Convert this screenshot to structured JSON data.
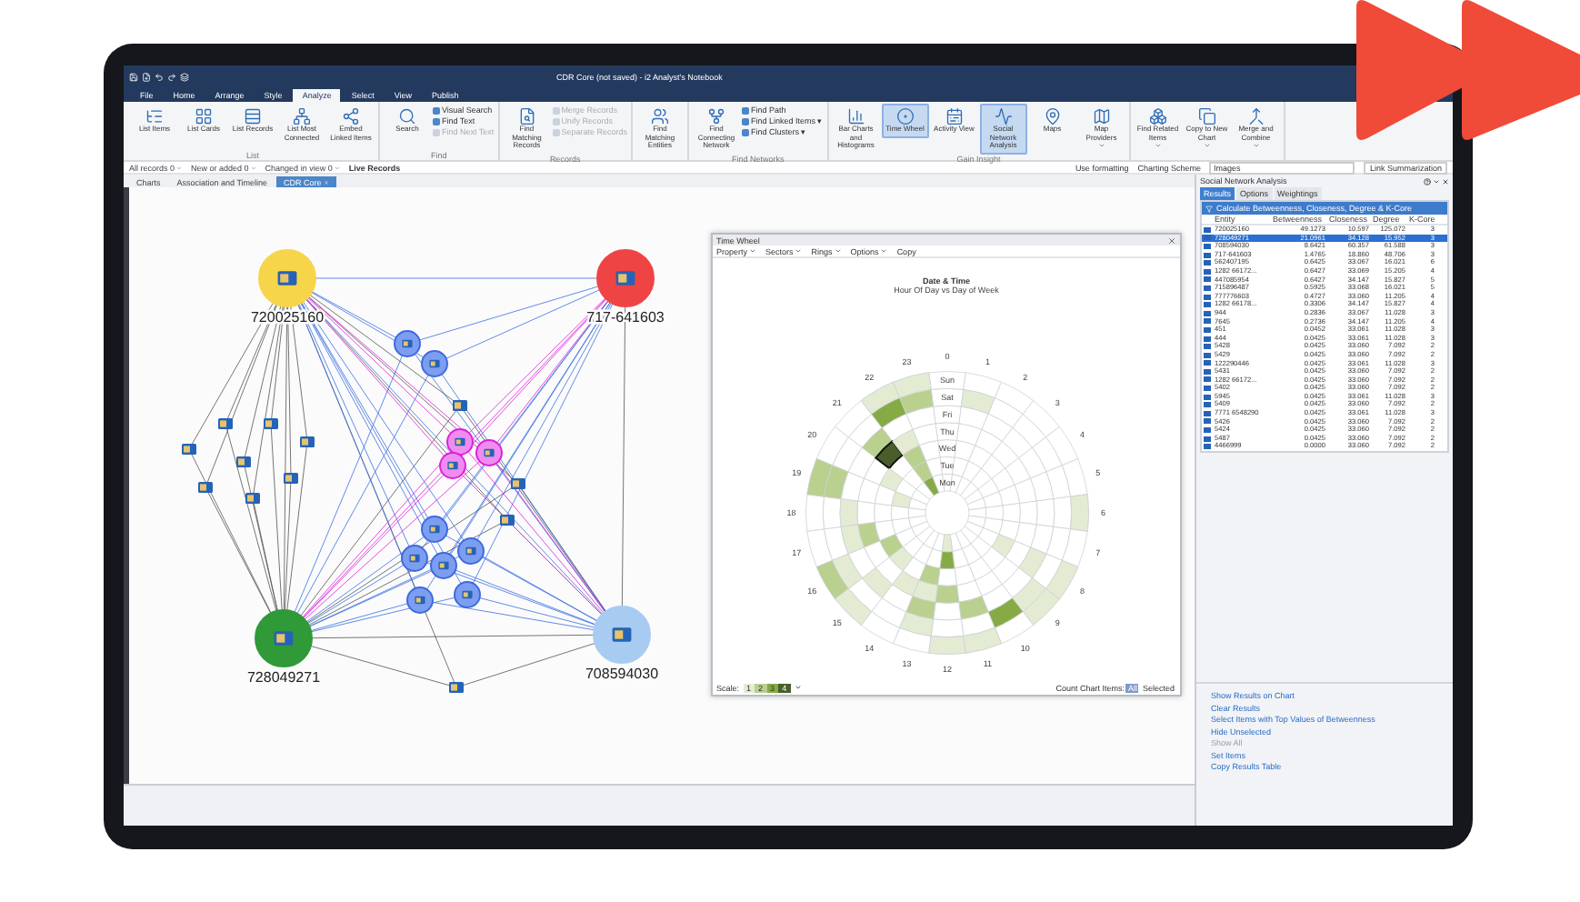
{
  "window": {
    "title": "CDR Core (not saved) - i2 Analyst's Notebook"
  },
  "ribbon_tabs": [
    {
      "label": "File",
      "selected": false
    },
    {
      "label": "Home",
      "selected": false
    },
    {
      "label": "Arrange",
      "selected": false
    },
    {
      "label": "Style",
      "selected": false
    },
    {
      "label": "Analyze",
      "selected": true
    },
    {
      "label": "Select",
      "selected": false
    },
    {
      "label": "View",
      "selected": false
    },
    {
      "label": "Publish",
      "selected": false
    }
  ],
  "ribbon_groups": [
    {
      "label": "List",
      "buttons": [
        {
          "kind": "large",
          "label": "List Items",
          "selected": false,
          "dropdown": false
        },
        {
          "kind": "large",
          "label": "List Cards",
          "selected": false,
          "dropdown": false
        },
        {
          "kind": "large",
          "label": "List Records",
          "selected": false,
          "dropdown": false
        },
        {
          "kind": "large",
          "label": "List Most Connected",
          "selected": false,
          "dropdown": false
        },
        {
          "kind": "large",
          "label": "Embed Linked Items",
          "selected": false,
          "dropdown": false
        }
      ]
    },
    {
      "label": "Find",
      "buttons": [
        {
          "kind": "large",
          "label": "Search",
          "selected": false,
          "dropdown": false
        },
        {
          "kind": "small",
          "label": "Visual Search",
          "disabled": false
        },
        {
          "kind": "small",
          "label": "Find Text",
          "disabled": false
        },
        {
          "kind": "small",
          "label": "Find Next Text",
          "disabled": true
        }
      ]
    },
    {
      "label": "Records",
      "buttons": [
        {
          "kind": "large",
          "label": "Find Matching Records",
          "selected": false,
          "dropdown": false
        },
        {
          "kind": "small",
          "label": "Merge Records",
          "disabled": true
        },
        {
          "kind": "small",
          "label": "Unify Records",
          "disabled": true
        },
        {
          "kind": "small",
          "label": "Separate Records",
          "disabled": true
        }
      ]
    },
    {
      "buttons": [
        {
          "kind": "large",
          "label": "Find Matching Entities",
          "selected": false,
          "dropdown": false
        }
      ]
    },
    {
      "label": "Find Networks",
      "buttons": [
        {
          "kind": "large",
          "label": "Find Connecting Network",
          "selected": false,
          "dropdown": false
        },
        {
          "kind": "small",
          "label": "Find Path",
          "disabled": false
        },
        {
          "kind": "small",
          "label": "Find Linked Items ▾",
          "disabled": false
        },
        {
          "kind": "small",
          "label": "Find Clusters ▾",
          "disabled": false
        }
      ]
    },
    {
      "label": "Gain Insight",
      "buttons": [
        {
          "kind": "large",
          "label": "Bar Charts and Histograms",
          "selected": false,
          "dropdown": false
        },
        {
          "kind": "large",
          "label": "Time Wheel",
          "selected": true,
          "dropdown": false
        },
        {
          "kind": "large",
          "label": "Activity View",
          "selected": false,
          "dropdown": false
        },
        {
          "kind": "large",
          "label": "Social Network Analysis",
          "selected": true,
          "dropdown": false
        },
        {
          "kind": "large",
          "label": "Maps",
          "selected": false,
          "dropdown": false
        },
        {
          "kind": "large",
          "label": "Map Providers",
          "selected": false,
          "dropdown": true
        }
      ]
    },
    {
      "buttons": [
        {
          "kind": "large",
          "label": "Find Related Items",
          "selected": false,
          "dropdown": true
        },
        {
          "kind": "large",
          "label": "Copy to New Chart",
          "selected": false,
          "dropdown": true
        },
        {
          "kind": "large",
          "label": "Merge and Combine",
          "selected": false,
          "dropdown": true
        }
      ]
    }
  ],
  "filter_bar": {
    "items": [
      "All records 0",
      "New or added 0",
      "Changed in view 0"
    ],
    "live_records": "Live Records",
    "use_formatting": "Use formatting",
    "scheme_label": "Charting Scheme",
    "scheme_value": "Images",
    "link_summarization": "Link Summarization"
  },
  "doc_tabs": [
    {
      "label": "Charts",
      "selected": false
    },
    {
      "label": "Association and Timeline",
      "selected": false
    },
    {
      "label": "CDR Core",
      "selected": true
    }
  ],
  "chart_nodes": [
    {
      "label": "720025160",
      "color": "#f6d54a"
    },
    {
      "label": "717-641603",
      "color": "#ef4444"
    },
    {
      "label": "728049271",
      "color": "#2f9a37"
    },
    {
      "label": "708594030",
      "color": "#a8cbf2"
    }
  ],
  "time_wheel": {
    "title": "Time Wheel",
    "toolbar": [
      {
        "label": "Property",
        "dropdown": true
      },
      {
        "label": "Sectors",
        "dropdown": true
      },
      {
        "label": "Rings",
        "dropdown": true
      },
      {
        "label": "Options",
        "dropdown": true
      },
      {
        "label": "Copy",
        "dropdown": false
      }
    ],
    "chart_title": "Date & Time",
    "chart_subtitle": "Hour Of Day vs Day of Week",
    "hours": [
      "0",
      "1",
      "2",
      "3",
      "4",
      "5",
      "6",
      "7",
      "8",
      "9",
      "10",
      "11",
      "12",
      "13",
      "14",
      "15",
      "16",
      "17",
      "18",
      "19",
      "20",
      "21",
      "22",
      "23"
    ],
    "days": [
      "Sun",
      "Sat",
      "Fri",
      "Thu",
      "Wed",
      "Tue",
      "Mon"
    ],
    "scale_label": "Scale:",
    "scale": [
      "1",
      "2",
      "3",
      "4"
    ],
    "count_label": "Count Chart Items:",
    "count_options": [
      {
        "label": "All",
        "selected": true
      },
      {
        "label": "Selected",
        "selected": false
      }
    ]
  },
  "sna": {
    "title": "Social Network Analysis",
    "tabs": [
      {
        "label": "Results",
        "selected": true
      },
      {
        "label": "Options",
        "selected": false
      },
      {
        "label": "Weightings",
        "selected": false
      }
    ],
    "calculate": "Calculate Betweenness, Closeness, Degree & K-Core",
    "columns": [
      "Entity",
      "Betweenness",
      "Closeness",
      "Degree",
      "K-Core"
    ],
    "rows": [
      {
        "cells": [
          "720025160",
          "49.1273",
          "10.597",
          "125.072",
          "3"
        ],
        "selected": false
      },
      {
        "cells": [
          "728049271",
          "21.0961",
          "34.128",
          "15.952",
          "3"
        ],
        "selected": true
      },
      {
        "cells": [
          "708594030",
          "8.6421",
          "60.357",
          "61.588",
          "3"
        ],
        "selected": false
      },
      {
        "cells": [
          "717-641603",
          "1.4765",
          "18.860",
          "48.706",
          "3"
        ],
        "selected": false
      },
      {
        "cells": [
          "562407195",
          "0.6425",
          "33.067",
          "16.021",
          "6"
        ],
        "selected": false
      },
      {
        "cells": [
          "1282 66172...",
          "0.6427",
          "33.069",
          "15.205",
          "4"
        ],
        "selected": false
      },
      {
        "cells": [
          "447085954",
          "0.6427",
          "34.147",
          "15.827",
          "5"
        ],
        "selected": false
      },
      {
        "cells": [
          "715896487",
          "0.5925",
          "33.068",
          "16.021",
          "5"
        ],
        "selected": false
      },
      {
        "cells": [
          "777776603",
          "0.4727",
          "33.060",
          "11.205",
          "4"
        ],
        "selected": false
      },
      {
        "cells": [
          "1282 66178...",
          "0.3306",
          "34.147",
          "15.827",
          "4"
        ],
        "selected": false
      },
      {
        "cells": [
          "944",
          "0.2836",
          "33.067",
          "11.028",
          "3"
        ],
        "selected": false
      },
      {
        "cells": [
          "7645",
          "0.2736",
          "34.147",
          "11.205",
          "4"
        ],
        "selected": false
      },
      {
        "cells": [
          "451",
          "0.0452",
          "33.061",
          "11.028",
          "3"
        ],
        "selected": false
      },
      {
        "cells": [
          "444",
          "0.0425",
          "33.061",
          "11.028",
          "3"
        ],
        "selected": false
      },
      {
        "cells": [
          "5428",
          "0.0425",
          "33.060",
          "7.092",
          "2"
        ],
        "selected": false
      },
      {
        "cells": [
          "5429",
          "0.0425",
          "33.060",
          "7.092",
          "2"
        ],
        "selected": false
      },
      {
        "cells": [
          "122290446",
          "0.0425",
          "33.061",
          "11.028",
          "3"
        ],
        "selected": false
      },
      {
        "cells": [
          "5431",
          "0.0425",
          "33.060",
          "7.092",
          "2"
        ],
        "selected": false
      },
      {
        "cells": [
          "1282 66172...",
          "0.0425",
          "33.060",
          "7.092",
          "2"
        ],
        "selected": false
      },
      {
        "cells": [
          "5402",
          "0.0425",
          "33.060",
          "7.092",
          "2"
        ],
        "selected": false
      },
      {
        "cells": [
          "5945",
          "0.0425",
          "33.061",
          "11.028",
          "3"
        ],
        "selected": false
      },
      {
        "cells": [
          "5409",
          "0.0425",
          "33.060",
          "7.092",
          "2"
        ],
        "selected": false
      },
      {
        "cells": [
          "7771 6548290",
          "0.0425",
          "33.061",
          "11.028",
          "3"
        ],
        "selected": false
      },
      {
        "cells": [
          "5426",
          "0.0425",
          "33.060",
          "7.092",
          "2"
        ],
        "selected": false
      },
      {
        "cells": [
          "5424",
          "0.0425",
          "33.060",
          "7.092",
          "2"
        ],
        "selected": false
      },
      {
        "cells": [
          "5487",
          "0.0425",
          "33.060",
          "7.092",
          "2"
        ],
        "selected": false
      },
      {
        "cells": [
          "4466999",
          "0.0000",
          "33.060",
          "7.092",
          "2"
        ],
        "selected": false
      }
    ],
    "actions": [
      {
        "label": "Show Results on Chart",
        "disabled": false
      },
      {
        "label": "Clear Results",
        "disabled": false
      },
      {
        "label": "Select Items with Top Values of Betweenness",
        "disabled": false
      },
      {
        "label": "Hide Unselected",
        "disabled": false
      },
      {
        "label": "Show All",
        "disabled": true
      },
      {
        "label": "Set Items",
        "disabled": false
      },
      {
        "label": "Copy Results Table",
        "disabled": false
      }
    ]
  }
}
